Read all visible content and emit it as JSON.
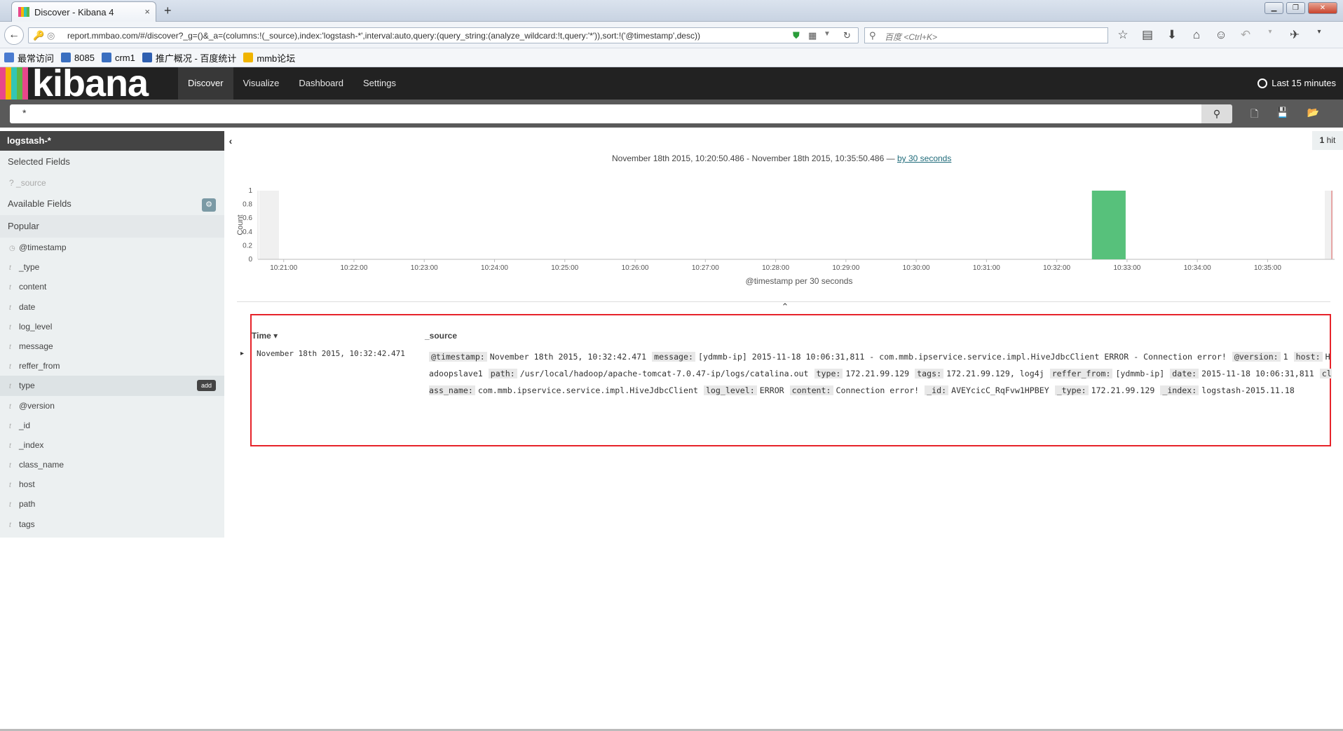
{
  "browser": {
    "tab_title": "Discover - Kibana 4",
    "new_tab": "+",
    "close_tab": "×",
    "url": "report.mmbao.com/#/discover?_g=()&_a=(columns:!(_source),index:'logstash-*',interval:auto,query:(query_string:(analyze_wildcard:!t,query:'*')),sort:!('@timestamp',desc))",
    "search_placeholder": "百度 <Ctrl+K>",
    "bookmarks": [
      {
        "label": "最常访问",
        "color": "#4a7bd0"
      },
      {
        "label": "8085",
        "color": "#3a6fc0"
      },
      {
        "label": "crm1",
        "color": "#3a6fc0"
      },
      {
        "label": "推广概况 - 百度统计",
        "color": "#2f5fb0"
      },
      {
        "label": "mmb论坛",
        "color": "#f0b400"
      }
    ]
  },
  "kibana": {
    "logo_text": "kibana",
    "logo_colors": [
      "#e8478b",
      "#f7b400",
      "#33c6b4",
      "#5fb547",
      "#e8478b"
    ],
    "nav": [
      {
        "label": "Discover",
        "active": true
      },
      {
        "label": "Visualize",
        "active": false
      },
      {
        "label": "Dashboard",
        "active": false
      },
      {
        "label": "Settings",
        "active": false
      }
    ],
    "time_picker": "Last 15 minutes",
    "query": "*",
    "index_pattern": "logstash-*",
    "selected_fields_header": "Selected Fields",
    "selected_fields": [
      "_source"
    ],
    "available_fields_header": "Available Fields",
    "popular_header": "Popular",
    "fields": [
      {
        "name": "@timestamp",
        "type": "clock"
      },
      {
        "name": "_type",
        "type": "t"
      },
      {
        "name": "content",
        "type": "t"
      },
      {
        "name": "date",
        "type": "t"
      },
      {
        "name": "log_level",
        "type": "t"
      },
      {
        "name": "message",
        "type": "t"
      },
      {
        "name": "reffer_from",
        "type": "t"
      },
      {
        "name": "type",
        "type": "t",
        "highlight": true,
        "action": "add"
      },
      {
        "name": "@version",
        "type": "t"
      },
      {
        "name": "_id",
        "type": "t"
      },
      {
        "name": "_index",
        "type": "t"
      },
      {
        "name": "class_name",
        "type": "t"
      },
      {
        "name": "host",
        "type": "t"
      },
      {
        "name": "path",
        "type": "t"
      },
      {
        "name": "tags",
        "type": "t"
      }
    ],
    "hits_count": "1",
    "hits_label": " hit",
    "time_range": "November 18th 2015, 10:20:50.486 - November 18th 2015, 10:35:50.486 —",
    "interval_link": "by 30 seconds",
    "table": {
      "col_time": "Time",
      "col_source": "_source",
      "rows": [
        {
          "time": "November 18th 2015, 10:32:42.471",
          "source": [
            [
              "@timestamp:",
              "November 18th 2015, 10:32:42.471"
            ],
            [
              "message:",
              "[ydmmb-ip] 2015-11-18 10:06:31,811 - com.mmb.ipservice.service.impl.HiveJdbcClient ERROR - Connection error!"
            ],
            [
              "@version:",
              "1"
            ],
            [
              "host:",
              "Hadoopslave1"
            ],
            [
              "path:",
              "/usr/local/hadoop/apache-tomcat-7.0.47-ip/logs/catalina.out"
            ],
            [
              "type:",
              "172.21.99.129"
            ],
            [
              "tags:",
              "172.21.99.129, log4j"
            ],
            [
              "reffer_from:",
              "[ydmmb-ip]"
            ],
            [
              "date:",
              "2015-11-18 10:06:31,811"
            ],
            [
              "class_name:",
              "com.mmb.ipservice.service.impl.HiveJdbcClient"
            ],
            [
              "log_level:",
              "ERROR"
            ],
            [
              "content:",
              "Connection error!"
            ],
            [
              "_id:",
              "AVEYcicC_RqFvw1HPBEY"
            ],
            [
              "_type:",
              "172.21.99.129"
            ],
            [
              "_index:",
              "logstash-2015.11.18"
            ]
          ]
        }
      ]
    }
  },
  "chart_data": {
    "type": "bar",
    "xlabel": "@timestamp per 30 seconds",
    "ylabel": "Count",
    "ylim": [
      0,
      1
    ],
    "yticks": [
      "0",
      "0.2",
      "0.4",
      "0.6",
      "0.8",
      "1"
    ],
    "xticks": [
      "10:21:00",
      "10:22:00",
      "10:23:00",
      "10:24:00",
      "10:25:00",
      "10:26:00",
      "10:27:00",
      "10:28:00",
      "10:29:00",
      "10:30:00",
      "10:31:00",
      "10:32:00",
      "10:33:00",
      "10:34:00",
      "10:35:00"
    ],
    "bars": [
      {
        "start": "10:32:30",
        "end": "10:33:00",
        "value": 1
      }
    ],
    "range_start": "10:20:50",
    "range_end": "10:35:50",
    "bar_color": "#57c17b"
  }
}
